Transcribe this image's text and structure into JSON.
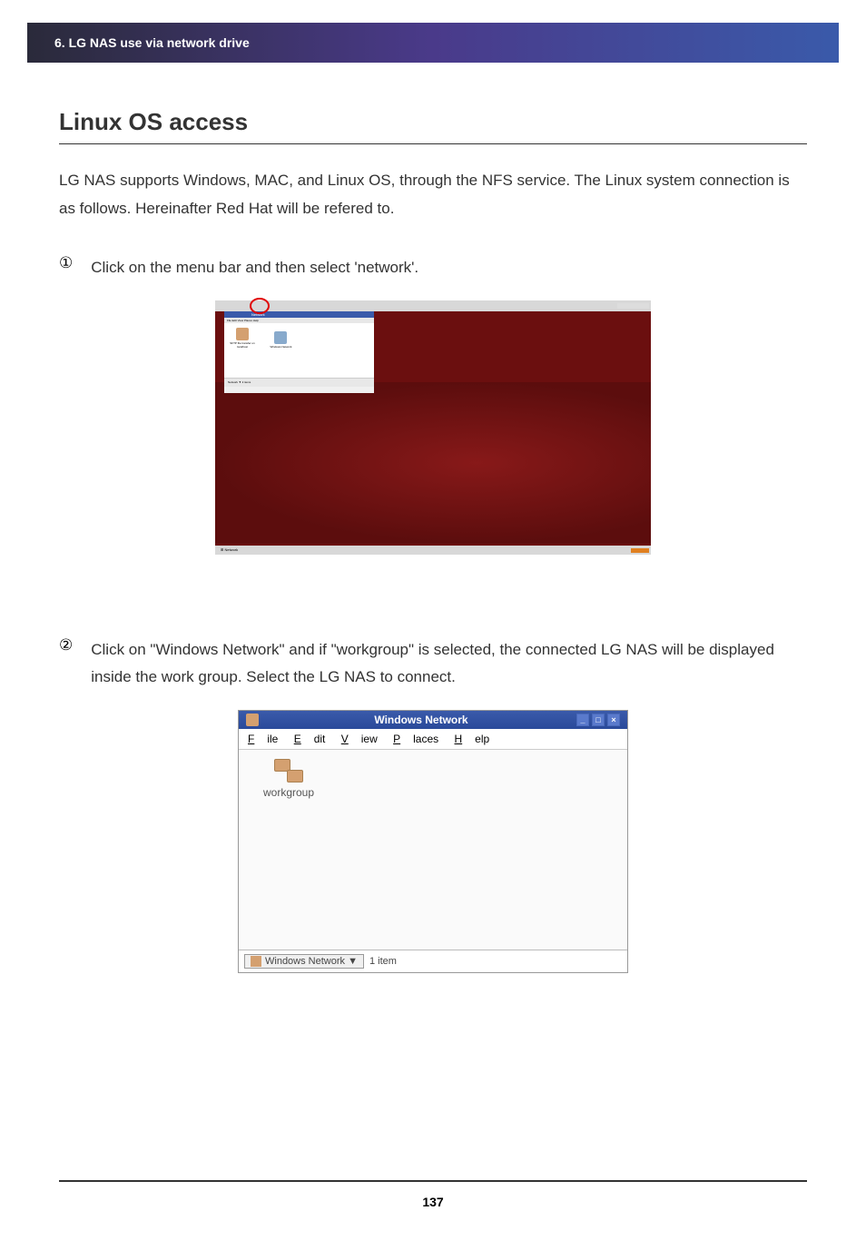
{
  "header": "6. LG NAS use via network drive",
  "title": "Linux OS access",
  "intro": "LG NAS supports Windows, MAC, and Linux OS, through the NFS service. The Linux system connection is as follows. Hereinafter Red Hat will be refered to.",
  "steps": [
    {
      "num": "①",
      "text": "Click on the menu bar and then select 'network'."
    },
    {
      "num": "②",
      "text": "Click on \"Windows Network\" and if \"workgroup\" is selected, the connected LG NAS will be displayed inside the work group. Select the LG NAS to connect."
    }
  ],
  "screenshot1": {
    "filewin_title": "Network",
    "menu": "File Edit View Places Help",
    "icon1_label": "SFTP file transfer on localhost",
    "icon2_label": "Windows Network",
    "status": "Network ▼ 2 items",
    "bottombar": "⊞  Network"
  },
  "screenshot2": {
    "title": "Windows Network",
    "menu": {
      "file": "File",
      "edit": "Edit",
      "view": "View",
      "places": "Places",
      "help": "Help"
    },
    "workgroup_label": "workgroup",
    "status_btn": "Windows Network ▼",
    "status_text": "1 item"
  },
  "page_number": "137"
}
